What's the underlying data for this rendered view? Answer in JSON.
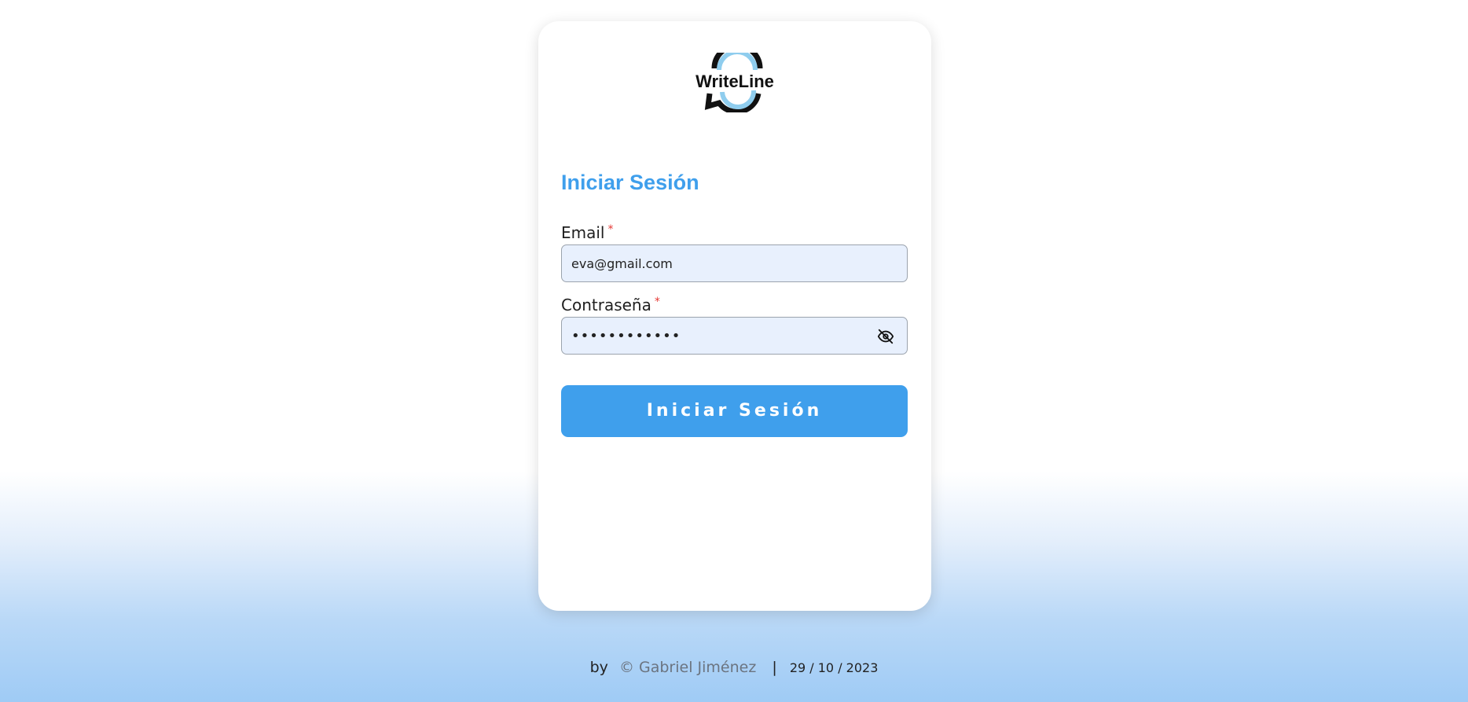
{
  "brand": {
    "logo_text": "WriteLine"
  },
  "login": {
    "title": "Iniciar Sesión",
    "email_label": "Email",
    "email_required": "*",
    "email_value": "eva@gmail.com",
    "password_label": "Contraseña",
    "password_required": "*",
    "password_value": "••••••••••••",
    "submit_label": "Iniciar Sesión"
  },
  "footer": {
    "by": "by",
    "author": "© Gabriel Jiménez",
    "separator": "|",
    "date": "29 / 10 / 2023"
  },
  "colors": {
    "accent": "#3f9fec",
    "field_bg": "#e8f0fd",
    "required": "#e53935"
  },
  "icons": {
    "logo": "writeline-logo",
    "password_toggle": "eye-off-icon"
  }
}
